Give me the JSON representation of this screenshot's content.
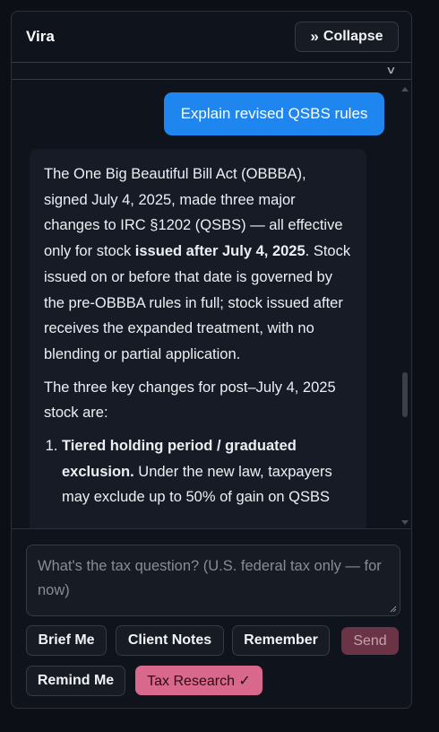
{
  "header": {
    "title": "Vira",
    "collapse_label": "Collapse"
  },
  "messages": {
    "user": "Explain revised QSBS rules",
    "assistant": {
      "p1_before": "The One Big Beautiful Bill Act (OBBBA), signed July 4, 2025, made three major changes to IRC §1202 (QSBS) — all effective only for stock ",
      "p1_bold": "issued after July 4, 2025",
      "p1_after": ". Stock issued on or before that date is governed by the pre-OBBBA rules in full; stock issued after receives the expanded treatment, with no blending or partial application.",
      "p2": "The three key changes for post–July 4, 2025 stock are:",
      "item1_bold": "Tiered holding period / graduated exclusion.",
      "item1_text": " Under the new law, taxpayers may exclude up to 50% of gain on QSBS"
    }
  },
  "composer": {
    "placeholder": "What's the tax question? (U.S. federal tax only — for now)"
  },
  "actions": {
    "brief_me": "Brief Me",
    "client_notes": "Client Notes",
    "remember": "Remember",
    "send": "Send",
    "remind_me": "Remind Me",
    "tax_research": "Tax Research ✓"
  },
  "colors": {
    "accent_blue": "#1f86ef",
    "send_bg": "#6b3346",
    "tax_research_bg": "#d8688c",
    "panel_bg": "#0f131b"
  },
  "icons": {
    "collapse": "double-chevron-right-icon",
    "strip": "chevron-down-icon",
    "resize": "resize-grip-icon"
  }
}
